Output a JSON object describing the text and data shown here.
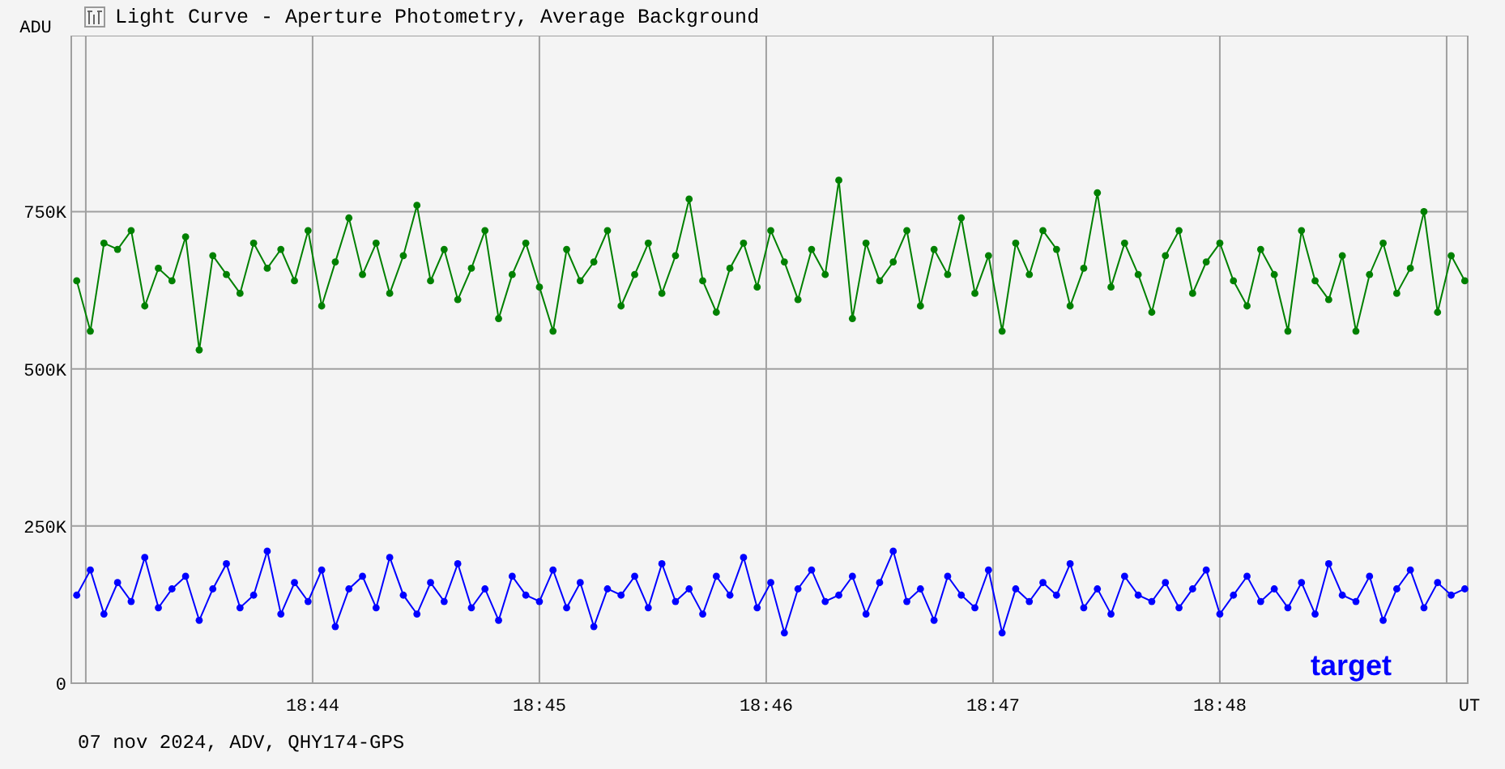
{
  "window": {
    "title": "Light Curve - Aperture Photometry, Average Background"
  },
  "chart": {
    "chart_data": {
      "type": "line",
      "grid": true,
      "ylabel": "ADU",
      "xlabel": "UT",
      "xlim": [
        1122.936,
        1129.093
      ],
      "ylim": [
        0,
        1030
      ],
      "xticks": [
        {
          "value": 1124,
          "label": "18:44"
        },
        {
          "value": 1125,
          "label": "18:45"
        },
        {
          "value": 1126,
          "label": "18:46"
        },
        {
          "value": 1127,
          "label": "18:47"
        },
        {
          "value": 1128,
          "label": "18:48"
        }
      ],
      "yticks": [
        {
          "value": 0,
          "label": "0"
        },
        {
          "value": 250,
          "label": "250K"
        },
        {
          "value": 500,
          "label": "500K"
        },
        {
          "value": 750,
          "label": "750K"
        }
      ],
      "x": [
        1122.96,
        1123.02,
        1123.08,
        1123.14,
        1123.2,
        1123.26,
        1123.32,
        1123.38,
        1123.44,
        1123.5,
        1123.56,
        1123.62,
        1123.68,
        1123.74,
        1123.8,
        1123.86,
        1123.92,
        1123.98,
        1124.04,
        1124.1,
        1124.16,
        1124.22,
        1124.28,
        1124.34,
        1124.4,
        1124.46,
        1124.52,
        1124.58,
        1124.64,
        1124.7,
        1124.76,
        1124.82,
        1124.88,
        1124.94,
        1125,
        1125.06,
        1125.12,
        1125.18,
        1125.24,
        1125.3,
        1125.36,
        1125.42,
        1125.48,
        1125.54,
        1125.6,
        1125.66,
        1125.72,
        1125.78,
        1125.84,
        1125.9,
        1125.96,
        1126.02,
        1126.08,
        1126.14,
        1126.2,
        1126.26,
        1126.32,
        1126.38,
        1126.44,
        1126.5,
        1126.56,
        1126.62,
        1126.68,
        1126.74,
        1126.8,
        1126.86,
        1126.92,
        1126.98,
        1127.04,
        1127.1,
        1127.16,
        1127.22,
        1127.28,
        1127.34,
        1127.4,
        1127.46,
        1127.52,
        1127.58,
        1127.64,
        1127.7,
        1127.76,
        1127.82,
        1127.88,
        1127.94,
        1128,
        1128.06,
        1128.12,
        1128.18,
        1128.24,
        1128.3,
        1128.36,
        1128.42,
        1128.48,
        1128.54,
        1128.6,
        1128.66,
        1128.72,
        1128.78,
        1128.84,
        1128.9,
        1128.96,
        1129.02,
        1129.08
      ],
      "series": [
        {
          "color": "#008000",
          "marker": "circle",
          "values": [
            640,
            560,
            700,
            690,
            720,
            600,
            660,
            640,
            710,
            530,
            680,
            650,
            620,
            700,
            660,
            690,
            640,
            720,
            600,
            670,
            740,
            650,
            700,
            620,
            680,
            760,
            640,
            690,
            610,
            660,
            720,
            580,
            650,
            700,
            630,
            560,
            690,
            640,
            670,
            720,
            600,
            650,
            700,
            620,
            680,
            770,
            640,
            590,
            660,
            700,
            630,
            720,
            670,
            610,
            690,
            650,
            800,
            580,
            700,
            640,
            670,
            720,
            600,
            690,
            650,
            740,
            620,
            680,
            560,
            700,
            650,
            720,
            690,
            600,
            660,
            780,
            630,
            700,
            650,
            590,
            680,
            720,
            620,
            670,
            700,
            640,
            600,
            690,
            650,
            560,
            720,
            640,
            610,
            680,
            560,
            650,
            700,
            620,
            660,
            750,
            590,
            680,
            640
          ]
        },
        {
          "name": "target",
          "color": "#0000ff",
          "marker": "circle",
          "values": [
            140,
            180,
            110,
            160,
            130,
            200,
            120,
            150,
            170,
            100,
            150,
            190,
            120,
            140,
            210,
            110,
            160,
            130,
            180,
            90,
            150,
            170,
            120,
            200,
            140,
            110,
            160,
            130,
            190,
            120,
            150,
            100,
            170,
            140,
            130,
            180,
            120,
            160,
            90,
            150,
            140,
            170,
            120,
            190,
            130,
            150,
            110,
            170,
            140,
            200,
            120,
            160,
            80,
            150,
            180,
            130,
            140,
            170,
            110,
            160,
            210,
            130,
            150,
            100,
            170,
            140,
            120,
            180,
            80,
            150,
            130,
            160,
            140,
            190,
            120,
            150,
            110,
            170,
            140,
            130,
            160,
            120,
            150,
            180,
            110,
            140,
            170,
            130,
            150,
            120,
            160,
            110,
            190,
            140,
            130,
            170,
            100,
            150,
            180,
            120,
            160,
            140,
            150
          ]
        }
      ]
    }
  },
  "footer": "07 nov 2024, ADV, QHY174-GPS"
}
